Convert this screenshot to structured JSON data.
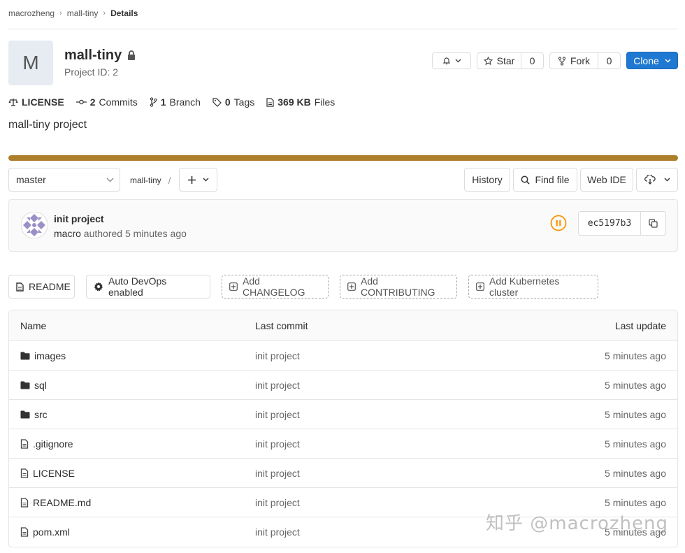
{
  "breadcrumb": {
    "items": [
      "macrozheng",
      "mall-tiny",
      "Details"
    ]
  },
  "project": {
    "avatar_letter": "M",
    "name": "mall-tiny",
    "id_text": "Project ID: 2",
    "description": "mall-tiny project"
  },
  "actions": {
    "star_label": "Star",
    "star_count": "0",
    "fork_label": "Fork",
    "fork_count": "0",
    "clone_label": "Clone",
    "clone_color": "#1f78d1"
  },
  "stats": {
    "license": "LICENSE",
    "commits_count": "2",
    "commits_label": "Commits",
    "branch_count": "1",
    "branch_label": "Branch",
    "tags_count": "0",
    "tags_label": "Tags",
    "files_size": "369 KB",
    "files_label": "Files"
  },
  "progress_color": "#ad7f2b",
  "tree": {
    "branch": "master",
    "path_root": "mall-tiny",
    "path_sep": "/",
    "history_label": "History",
    "find_file_label": "Find file",
    "web_ide_label": "Web IDE"
  },
  "last_commit": {
    "title": "init project",
    "author": "macro",
    "meta": "authored 5 minutes ago",
    "sha": "ec5197b3",
    "pipeline_color": "#fc9403"
  },
  "quick_actions": [
    {
      "label": "README",
      "style": "solid",
      "icon": "file-icon"
    },
    {
      "label": "Auto DevOps enabled",
      "style": "solid",
      "icon": "gear-icon"
    },
    {
      "label": "Add CHANGELOG",
      "style": "dashed",
      "icon": "plus-square-icon"
    },
    {
      "label": "Add CONTRIBUTING",
      "style": "dashed",
      "icon": "plus-square-icon"
    },
    {
      "label": "Add Kubernetes cluster",
      "style": "dashed",
      "icon": "plus-square-icon"
    }
  ],
  "file_table": {
    "headers": [
      "Name",
      "Last commit",
      "Last update"
    ],
    "rows": [
      {
        "name": "images",
        "type": "folder",
        "commit": "init project",
        "updated": "5 minutes ago"
      },
      {
        "name": "sql",
        "type": "folder",
        "commit": "init project",
        "updated": "5 minutes ago"
      },
      {
        "name": "src",
        "type": "folder",
        "commit": "init project",
        "updated": "5 minutes ago"
      },
      {
        "name": ".gitignore",
        "type": "file",
        "commit": "init project",
        "updated": "5 minutes ago"
      },
      {
        "name": "LICENSE",
        "type": "file",
        "commit": "init project",
        "updated": "5 minutes ago"
      },
      {
        "name": "README.md",
        "type": "file",
        "commit": "init project",
        "updated": "5 minutes ago"
      },
      {
        "name": "pom.xml",
        "type": "file",
        "commit": "init project",
        "updated": "5 minutes ago"
      }
    ]
  },
  "watermark": "知乎 @macrozheng"
}
